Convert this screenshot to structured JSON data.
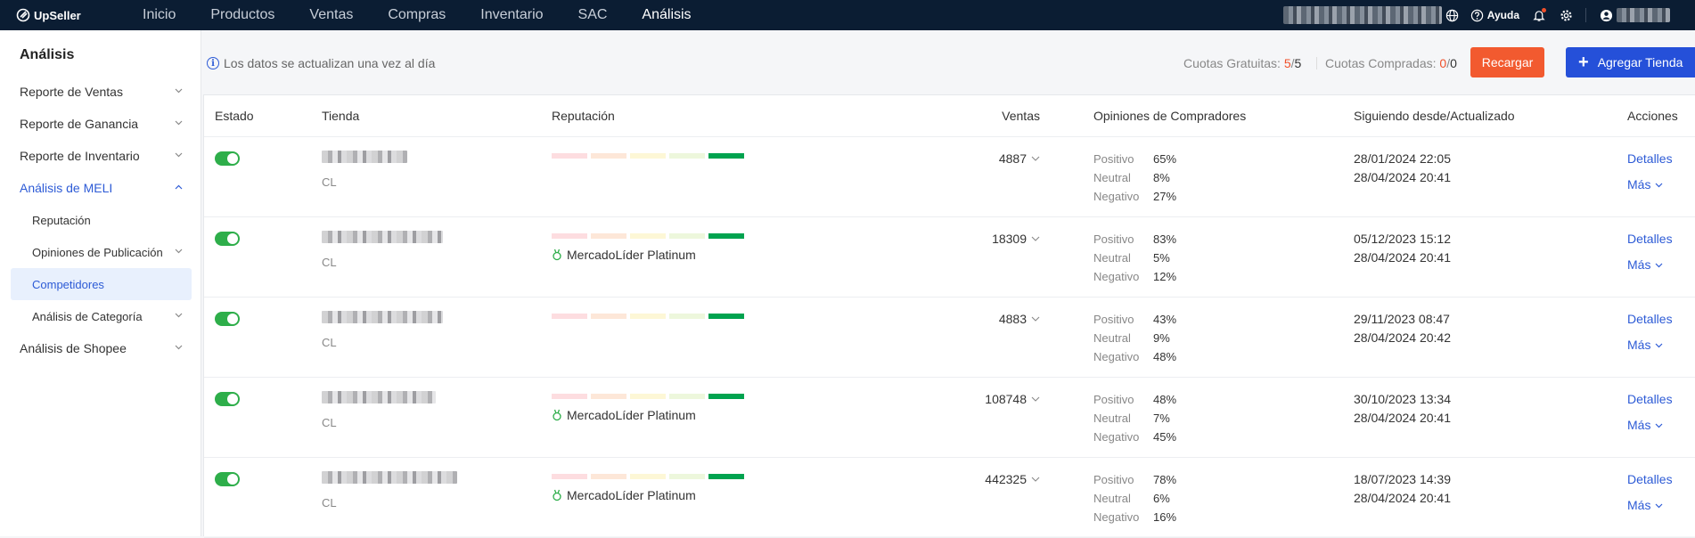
{
  "brand": {
    "name": "UpSeller"
  },
  "nav": {
    "items": [
      {
        "label": "Inicio"
      },
      {
        "label": "Productos"
      },
      {
        "label": "Ventas"
      },
      {
        "label": "Compras"
      },
      {
        "label": "Inventario"
      },
      {
        "label": "SAC"
      },
      {
        "label": "Análisis",
        "active": true
      }
    ],
    "help_label": "Ayuda"
  },
  "sidebar": {
    "title": "Análisis",
    "items": [
      {
        "label": "Reporte de Ventas"
      },
      {
        "label": "Reporte de Ganancia"
      },
      {
        "label": "Reporte de Inventario"
      },
      {
        "label": "Análisis de MELI",
        "open": true
      },
      {
        "label": "Reputación"
      },
      {
        "label": "Opiniones de Publicación"
      },
      {
        "label": "Competidores",
        "active": true
      },
      {
        "label": "Análisis de Categoría"
      },
      {
        "label": "Análisis de Shopee"
      }
    ]
  },
  "info": {
    "text": "Los datos se actualizan una vez al día",
    "free_quota_label": "Cuotas Gratuitas:",
    "free_used": "5",
    "free_total": "5",
    "bought_quota_label": "Cuotas Compradas:",
    "bought_used": "0",
    "bought_total": "0",
    "recargar_label": "Recargar",
    "agregar_label": "Agregar Tienda"
  },
  "table": {
    "headers": {
      "estado": "Estado",
      "tienda": "Tienda",
      "reputacion": "Reputación",
      "ventas": "Ventas",
      "opiniones": "Opiniones de Compradores",
      "siguiendo": "Siguiendo desde/Actualizado",
      "acciones": "Acciones"
    },
    "labels": {
      "positivo": "Positivo",
      "neutral": "Neutral",
      "negativo": "Negativo",
      "detalles": "Detalles",
      "mas": "Más"
    },
    "rows": [
      {
        "enabled": true,
        "country": "CL",
        "medal": "",
        "sales": "4887",
        "positivo": "65%",
        "neutral": "8%",
        "negativo": "27%",
        "since": "28/01/2024 22:05",
        "updated": "28/04/2024 20:41"
      },
      {
        "enabled": true,
        "country": "CL",
        "medal": "MercadoLíder Platinum",
        "sales": "18309",
        "positivo": "83%",
        "neutral": "5%",
        "negativo": "12%",
        "since": "05/12/2023 15:12",
        "updated": "28/04/2024 20:41"
      },
      {
        "enabled": true,
        "country": "CL",
        "medal": "",
        "sales": "4883",
        "positivo": "43%",
        "neutral": "9%",
        "negativo": "48%",
        "since": "29/11/2023 08:47",
        "updated": "28/04/2024 20:42"
      },
      {
        "enabled": true,
        "country": "CL",
        "medal": "MercadoLíder Platinum",
        "sales": "108748",
        "positivo": "48%",
        "neutral": "7%",
        "negativo": "45%",
        "since": "30/10/2023 13:34",
        "updated": "28/04/2024 20:41"
      },
      {
        "enabled": true,
        "country": "CL",
        "medal": "MercadoLíder Platinum",
        "sales": "442325",
        "positivo": "78%",
        "neutral": "6%",
        "negativo": "16%",
        "since": "18/07/2023 14:39",
        "updated": "28/04/2024 20:41"
      }
    ]
  }
}
